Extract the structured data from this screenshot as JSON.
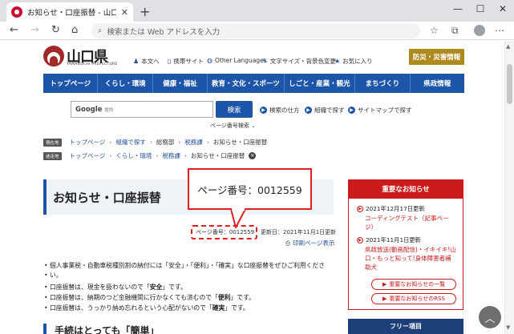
{
  "browser": {
    "tab_title": "お知らせ・口座振替 - 山口県ホーム",
    "tab_close": "✕",
    "new_tab": "+",
    "address_placeholder": "検索または Web アドレスを入力",
    "min": "—",
    "max": "☐",
    "close": "✕"
  },
  "header": {
    "logo_text": "山口県",
    "logo_sub": "YAMAGUCHI PREFECTURE",
    "utils": [
      "本文へ",
      "携帯サイト",
      "Other Languages",
      "文字サイズ・背景色変更",
      "お気に入り"
    ],
    "disaster_button": "防災・災害情報"
  },
  "global_nav": [
    "トップページ",
    "くらし・環境",
    "健康・福祉",
    "教育・文化・スポーツ",
    "しごと・産業・観光",
    "まちづくり",
    "県政情報"
  ],
  "search": {
    "google_label": "Google",
    "google_sub": "提供",
    "button": "検索",
    "links": [
      "検索の仕方",
      "組織で探す",
      "サイトマップで探す"
    ],
    "page_number_search": "ページ番号検索"
  },
  "breadcrumb1": {
    "tag": "現在地",
    "items": [
      "トップページ",
      "組織で探す",
      "総務部",
      "税務課"
    ],
    "current": "お知らせ・口座振替"
  },
  "breadcrumb2": {
    "tag": "迷走地",
    "items": [
      "トップページ",
      "くらし・環境",
      "税務課"
    ],
    "current": "お知らせ・口座振替"
  },
  "main": {
    "title": "お知らせ・口座振替",
    "callout": "ページ番号：0012559",
    "page_number": "ページ番号：0012559",
    "updated": "更新日：2021年11月1日更新",
    "print": "印刷ページ表示",
    "bullet1a": "個人事業税・自動車税種別割の納付には「安全」・「便利」・「確実」な口座振替をぜひご利用くださ",
    "bullet1b": "い。",
    "bullet2_pre": "口座振替は、現金を扱わないので「",
    "bullet2_b": "安全",
    "bullet2_post": "」です。",
    "bullet3_pre": "口座振替は、納期のつど金融機関に行かなくても済むので「",
    "bullet3_b": "便利",
    "bullet3_post": "」です。",
    "bullet4_pre": "口座振替は、うっかり納め忘れるという心配がないので「",
    "bullet4_b": "確実",
    "bullet4_post": "」です。",
    "section_heading": "手続はとっても「簡単」"
  },
  "right_panel": {
    "heading": "重要なお知らせ",
    "news": [
      {
        "date": "2021年12月17日更新",
        "title": "コーディングテスト（記事ページ）"
      },
      {
        "date": "2021年11月1日更新",
        "title": "県政放送(動画配信)・イキイキ!山口・もっと知って!身体障害者補助犬"
      }
    ],
    "list_button": "重要なお知らせの一覧",
    "rss_button": "重要なお知らせのRSS",
    "free_heading": "フリー項目"
  },
  "colors": {
    "nav_blue": "#1d56a8",
    "alert_red": "#cb1a1a",
    "disaster_gold": "#ad8a1d"
  }
}
